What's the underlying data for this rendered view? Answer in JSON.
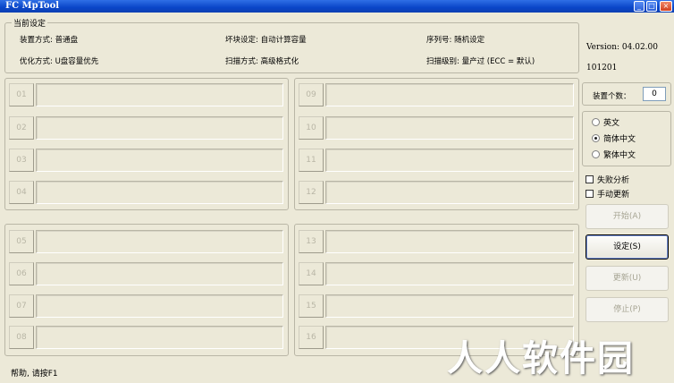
{
  "window": {
    "title": "FC MpTool",
    "minimize": "_",
    "maximize": "□",
    "close": "×"
  },
  "current_settings": {
    "group_title": "当前设定",
    "device_mode": "装置方式: 普通盘",
    "bad_block": "坏块设定: 自动计算容量",
    "serial": "序列号: 随机设定",
    "optimize": "优化方式: U盘容量优先",
    "scan_mode": "扫描方式: 高级格式化",
    "scan_level": "扫描级别: 量产过 (ECC = 默认)"
  },
  "slots": {
    "g1_left": [
      "01",
      "02",
      "03",
      "04"
    ],
    "g1_right": [
      "09",
      "10",
      "11",
      "12"
    ],
    "g2_left": [
      "05",
      "06",
      "07",
      "08"
    ],
    "g2_right": [
      "13",
      "14",
      "15",
      "16"
    ]
  },
  "side": {
    "version": "Version: 04.02.00",
    "build": "101201",
    "device_count_label": "装置个数：",
    "device_count": "0",
    "lang_en": "英文",
    "lang_sc": "简体中文",
    "lang_tc": "繁体中文",
    "fail_analysis": "失败分析",
    "manual_update": "手动更新"
  },
  "buttons": {
    "start": "开始(A)",
    "settings": "设定(S)",
    "update": "更新(U)",
    "stop": "停止(P)"
  },
  "status_bar": "帮助, 请按F1",
  "watermark": "人人软件园"
}
